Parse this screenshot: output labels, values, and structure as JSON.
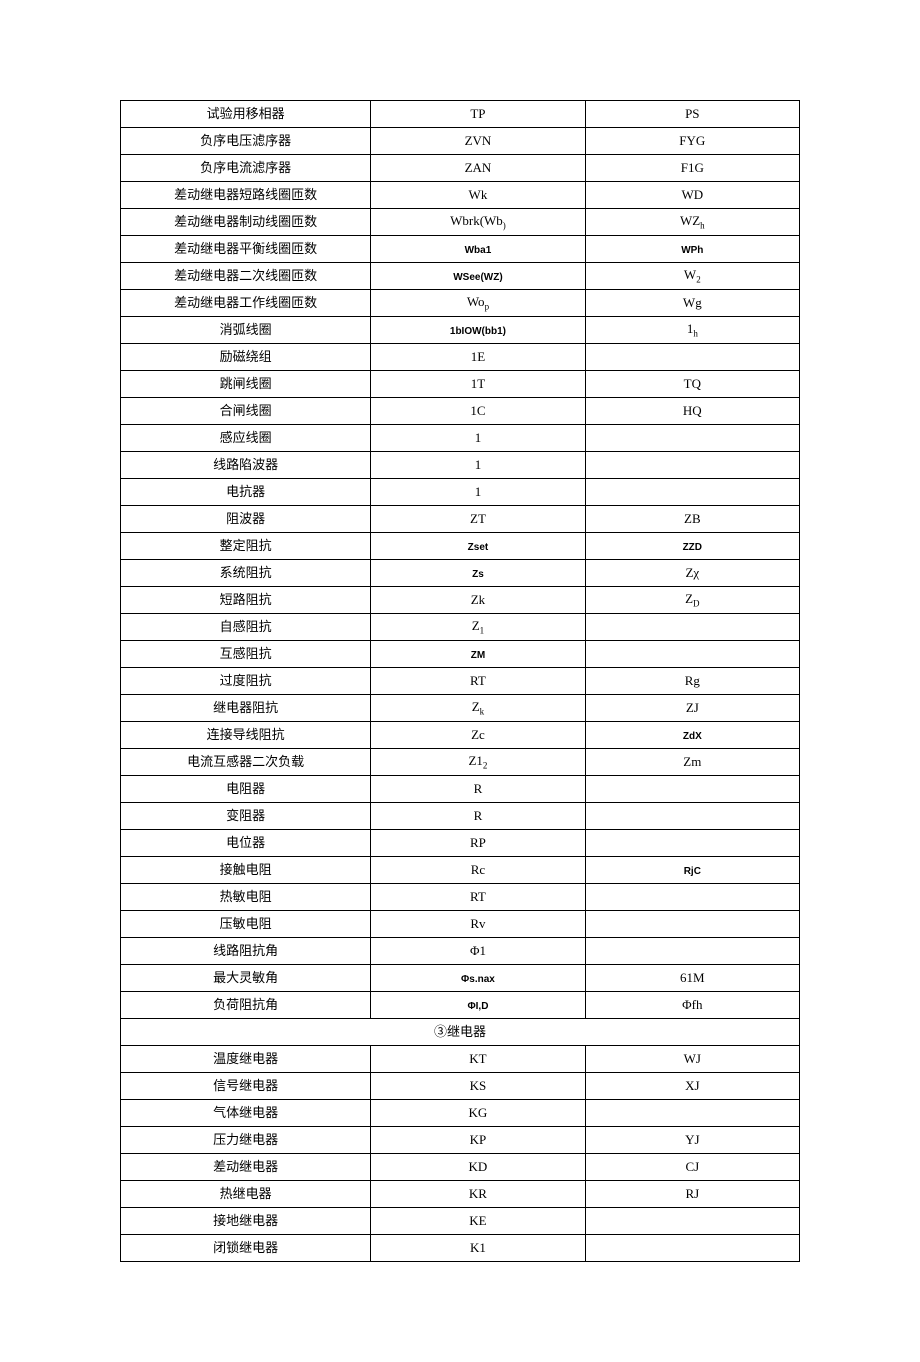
{
  "rows": [
    {
      "c1": "试验用移相器",
      "c2": "TP",
      "c3": "PS"
    },
    {
      "c1": "负序电压滤序器",
      "c2": "ZVN",
      "c3": "FYG"
    },
    {
      "c1": "负序电流滤序器",
      "c2": "ZAN",
      "c3": "F1G"
    },
    {
      "c1": "差动继电器短路线圈匝数",
      "c2": "Wk",
      "c3": "WD"
    },
    {
      "c1": "差动继电器制动线圈匝数",
      "c2": "Wbrk(Wb)",
      "c3": "WZh",
      "c2sub": true,
      "c3sub": true
    },
    {
      "c1": "差动继电器平衡线圈匝数",
      "c2": "Wba1",
      "c3": "WPh",
      "c2small": true,
      "c3small": true
    },
    {
      "c1": "差动继电器二次线圈匝数",
      "c2": "WSee(WZ)",
      "c3": "W2",
      "c2small": true,
      "c3sub": true
    },
    {
      "c1": "差动继电器工作线圈匝数",
      "c2": "Wop",
      "c3": "Wg",
      "c2sub": true
    },
    {
      "c1": "消弧线圈",
      "c2": "1bIOW(bb1)",
      "c3": "1h",
      "c2small": true,
      "c3sub": true
    },
    {
      "c1": "励磁绕组",
      "c2": "1E",
      "c3": ""
    },
    {
      "c1": "跳闸线圈",
      "c2": "1T",
      "c3": "TQ"
    },
    {
      "c1": "合闸线圈",
      "c2": "1C",
      "c3": "HQ"
    },
    {
      "c1": "感应线圈",
      "c2": "1",
      "c3": ""
    },
    {
      "c1": "线路陷波器",
      "c2": "1",
      "c3": ""
    },
    {
      "c1": "电抗器",
      "c2": "1",
      "c3": ""
    },
    {
      "c1": "阻波器",
      "c2": "ZT",
      "c3": "ZB"
    },
    {
      "c1": "整定阻抗",
      "c2": "Zset",
      "c3": "ZZD",
      "c2small": true,
      "c3small": true
    },
    {
      "c1": "系统阻抗",
      "c2": "Zs",
      "c3": "Zχ",
      "c2small": true
    },
    {
      "c1": "短路阻抗",
      "c2": "Zk",
      "c3": "ZD",
      "c3sub": true
    },
    {
      "c1": "自感阻抗",
      "c2": "Z1",
      "c3": "",
      "c2sub": true
    },
    {
      "c1": "互感阻抗",
      "c2": "ZM",
      "c3": "",
      "c2small": true
    },
    {
      "c1": "过度阻抗",
      "c2": "RT",
      "c3": "Rg"
    },
    {
      "c1": "继电器阻抗",
      "c2": "Zk",
      "c3": "ZJ",
      "c2sub": true
    },
    {
      "c1": "连接导线阻抗",
      "c2": "Zc",
      "c3": "ZdX",
      "c3small": true
    },
    {
      "c1": "电流互感器二次负载",
      "c2": "Z12",
      "c3": "Zm",
      "c2sub": true
    },
    {
      "c1": "电阻器",
      "c2": "R",
      "c3": ""
    },
    {
      "c1": "变阻器",
      "c2": "R",
      "c3": ""
    },
    {
      "c1": "电位器",
      "c2": "RP",
      "c3": ""
    },
    {
      "c1": "接触电阻",
      "c2": "Rc",
      "c3": "RjC",
      "c3small": true
    },
    {
      "c1": "热敏电阻",
      "c2": "RT",
      "c3": ""
    },
    {
      "c1": "压敏电阻",
      "c2": "Rv",
      "c3": ""
    },
    {
      "c1": "线路阻抗角",
      "c2": "Φ1",
      "c3": ""
    },
    {
      "c1": "最大灵敏角",
      "c2": "Φs.nax",
      "c3": "61M",
      "c2small": true
    },
    {
      "c1": "负荷阻抗角",
      "c2": "ΦI,D",
      "c3": "Φfh",
      "c2small": true
    }
  ],
  "section": "③继电器",
  "rows2": [
    {
      "c1": "温度继电器",
      "c2": "KT",
      "c3": "WJ"
    },
    {
      "c1": "信号继电器",
      "c2": "KS",
      "c3": "XJ"
    },
    {
      "c1": "气体继电器",
      "c2": "KG",
      "c3": ""
    },
    {
      "c1": "压力继电器",
      "c2": "KP",
      "c3": "YJ"
    },
    {
      "c1": "差动继电器",
      "c2": "KD",
      "c3": "CJ"
    },
    {
      "c1": "热继电器",
      "c2": "KR",
      "c3": "RJ"
    },
    {
      "c1": "接地继电器",
      "c2": "KE",
      "c3": ""
    },
    {
      "c1": "闭锁继电器",
      "c2": "K1",
      "c3": ""
    }
  ]
}
